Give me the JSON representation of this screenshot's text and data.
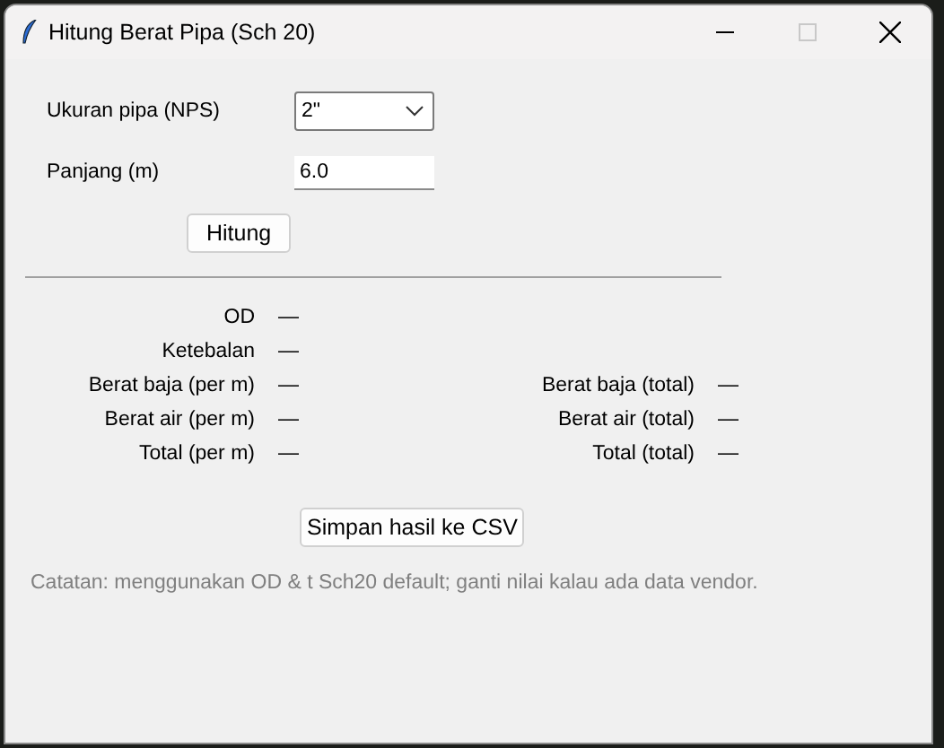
{
  "window": {
    "title": "Hitung Berat Pipa (Sch 20)"
  },
  "form": {
    "size_label": "Ukuran pipa (NPS)",
    "size_value": "2\"",
    "length_label": "Panjang (m)",
    "length_value": "6.0"
  },
  "calculate_button": "Hitung",
  "results": [
    {
      "label": "OD",
      "value": "—"
    },
    {
      "label": "Ketebalan",
      "value": "—"
    },
    {
      "label": "Berat baja (per m)",
      "value": "—",
      "total_label": "Berat baja (total)",
      "total_value": "—"
    },
    {
      "label": "Berat air (per m)",
      "value": "—",
      "total_label": "Berat air (total)",
      "total_value": "—"
    },
    {
      "label": "Total (per m)",
      "value": "—",
      "total_label": "Total (total)",
      "total_value": "—"
    }
  ],
  "save_button": "Simpan hasil ke CSV",
  "note": "Catatan: menggunakan OD & t Sch20 default; ganti nilai kalau ada data vendor."
}
